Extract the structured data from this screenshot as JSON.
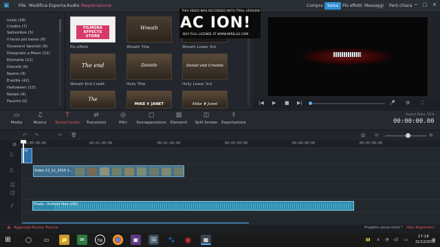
{
  "menubar": {
    "logo_glyph": "▣",
    "items": [
      "File",
      "Modifica",
      "Esporta",
      "Audio",
      "Registrazione"
    ],
    "active_item": "Registrazione",
    "right_buttons": [
      "Compra",
      "Salva",
      "Più effetti",
      "Messaggi",
      "Però chiara"
    ],
    "window_controls": [
      "─",
      "□",
      "✕"
    ]
  },
  "categories": [
    "Inizio (28)",
    "Credito (7)",
    "Settembre (5)",
    "Il terzo più basso (8)",
    "Occasioni Speciali (9)",
    "Disegnato a Mano (12)",
    "Etichette (12)",
    "Dolcetti (6)",
    "Nastro (9)",
    "Eredità (42)",
    "Halloween (13)",
    "Natale (9)",
    "Favoriti (0)"
  ],
  "thumbnails": [
    {
      "label": "Più effetti",
      "text": "FILMORA EFFECTS STORE",
      "style": "store"
    },
    {
      "label": "Wreath Title",
      "text": "Wreath",
      "style": "photo"
    },
    {
      "label": "Wreath Lower 3rd",
      "text": "",
      "style": "photo-dark"
    },
    {
      "label": "Wreath End Credit",
      "text": "The end",
      "style": "photo"
    },
    {
      "label": "Holly Title",
      "text": "Daniele",
      "style": "photo"
    },
    {
      "label": "Holly Lower 3rd",
      "text": "Daniel and Cristine",
      "style": "photo"
    },
    {
      "label": "",
      "text": "The",
      "style": "photo"
    },
    {
      "label": "",
      "text": "MIKE ❦ JANET",
      "style": "photo"
    },
    {
      "label": "",
      "text": "Mike ❦ Janet",
      "style": "photo"
    }
  ],
  "preview": {
    "watermark_line1": "THIS VIDEO WAS RECORDED WITH TRIAL VERSION",
    "watermark_big": "AC ION!",
    "watermark_line3": "BUY FULL LICENSE AT WWW.MIRILLIS.COM",
    "controls": [
      "|◀",
      "▶",
      "■",
      "▶|"
    ],
    "right_controls": [
      "🎤",
      "⚙",
      "⛶"
    ]
  },
  "toolbar": {
    "items": [
      {
        "label": "Media",
        "icon": "▭"
      },
      {
        "label": "Musica",
        "icon": "♫"
      },
      {
        "label": "Testo/Credito",
        "icon": "T"
      },
      {
        "label": "Transizioni",
        "icon": "⇄"
      },
      {
        "label": "Filtri",
        "icon": "◎"
      },
      {
        "label": "Sovrapposizioni",
        "icon": "▢"
      },
      {
        "label": "Elementi",
        "icon": "▨"
      },
      {
        "label": "Split Screen",
        "icon": "◫"
      },
      {
        "label": "Esportazione",
        "icon": "⇪"
      }
    ],
    "active": "Testo/Credito",
    "aspect_ratio": "Aspect Ratio: 16:9",
    "timecode": "00:00:00.00"
  },
  "timeline": {
    "toolbar_buttons": [
      "↶",
      "↷",
      "✂",
      "🗑"
    ],
    "ticks": [
      "00:00:00:00",
      "00:01:00:00",
      "00:02:00:00",
      "00:03:00:00",
      "00:04:00:00",
      "00:05:00:00"
    ],
    "title_clip": "vid",
    "video_clip": "Video 13_12_2016 1...",
    "audio_clip": "Prada - Android Porn (HQ)",
    "zoom_icons": [
      "▥",
      "⊖",
      "⊕"
    ]
  },
  "status": {
    "add_track": "Aggiungi Nuova Traccia",
    "project_name": "Progetto senza titolo *",
    "project_status": "(Non Registrato)"
  },
  "taskbar": {
    "start": "⊞",
    "apps": [
      "◯",
      "▭",
      "📁",
      "✉",
      "hp",
      "◉",
      "▣",
      "🖼",
      "🐾",
      "◉",
      "▦"
    ],
    "time": "17:18",
    "date": "21/12/2016"
  },
  "colors": {
    "accent": "#e65c8a",
    "active_tool": "#e05a5a",
    "salva": "#2f8fd6",
    "video_clip": "#3e6f8e",
    "audio_clip": "#2d88a8"
  }
}
